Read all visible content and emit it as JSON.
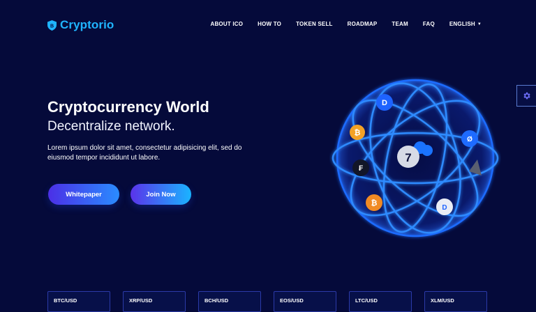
{
  "brand": {
    "name": "Cryptorio",
    "color": "#1fb4ff"
  },
  "nav": {
    "items": [
      "ABOUT ICO",
      "HOW TO",
      "TOKEN SELL",
      "ROADMAP",
      "TEAM",
      "FAQ"
    ],
    "language": "ENGLISH"
  },
  "hero": {
    "title": "Cryptocurrency World",
    "subtitle": "Decentralize network.",
    "text": "Lorem ipsum dolor sit amet, consectetur adipisicing elit, sed do eiusmod tempor incididunt ut labore."
  },
  "buttons": {
    "whitepaper": "Whitepaper",
    "join": "Join Now"
  },
  "colors": {
    "background": "#050a3a",
    "button_from": "#4b2fe6",
    "button_to": "#1ab4ff"
  },
  "icons": [
    "settings-gear-icon",
    "crypto-sphere-illustration"
  ],
  "tickers": [
    "BTC/USD",
    "XRP/USD",
    "BCH/USD",
    "EOS/USD",
    "LTC/USD",
    "XLM/USD"
  ]
}
